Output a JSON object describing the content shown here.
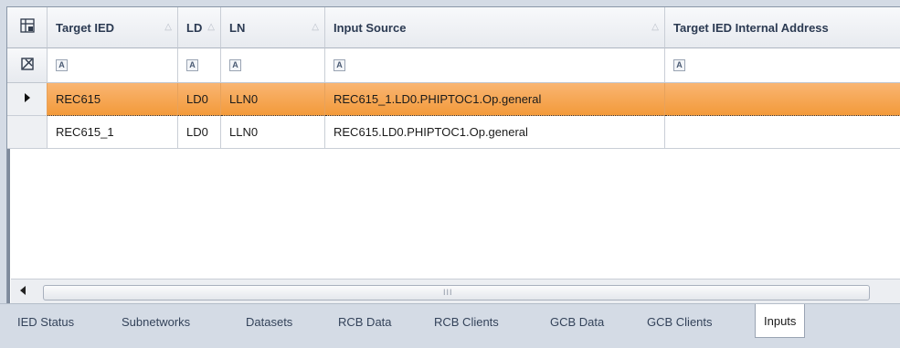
{
  "grid": {
    "columns": [
      {
        "label": "Target IED",
        "sort": "△"
      },
      {
        "label": "LD",
        "sort": "△"
      },
      {
        "label": "LN",
        "sort": "△"
      },
      {
        "label": "Input Source",
        "sort": "△"
      },
      {
        "label": "Target IED Internal Address",
        "sort": ""
      }
    ],
    "filter_icon": "A",
    "rows": [
      {
        "target_ied": "REC615",
        "ld": "LD0",
        "ln": "LLN0",
        "input_source": "REC615_1.LD0.PHIPTOC1.Op.general",
        "internal_address": "",
        "selected": true
      },
      {
        "target_ied": "REC615_1",
        "ld": "LD0",
        "ln": "LLN0",
        "input_source": "REC615.LD0.PHIPTOC1.Op.general",
        "internal_address": "",
        "selected": false
      }
    ]
  },
  "icons": {
    "column_chooser": "column-chooser-icon",
    "filter_toggle": "filter-toggle-icon",
    "row_pointer": "row-pointer-icon",
    "scroll_left": "scroll-left-icon"
  },
  "scrollbar": {
    "grip": "III"
  },
  "tabs": [
    {
      "label": "IED Status"
    },
    {
      "label": "Subnetworks"
    },
    {
      "label": "Datasets"
    },
    {
      "label": "RCB Data"
    },
    {
      "label": "RCB Clients"
    },
    {
      "label": "GCB Data"
    },
    {
      "label": "GCB Clients"
    },
    {
      "label": "Inputs",
      "active": true
    }
  ],
  "colors": {
    "selected_row": "#f5a24a",
    "header_text": "#2b3a52",
    "tab_bg": "#d4dbe5"
  }
}
